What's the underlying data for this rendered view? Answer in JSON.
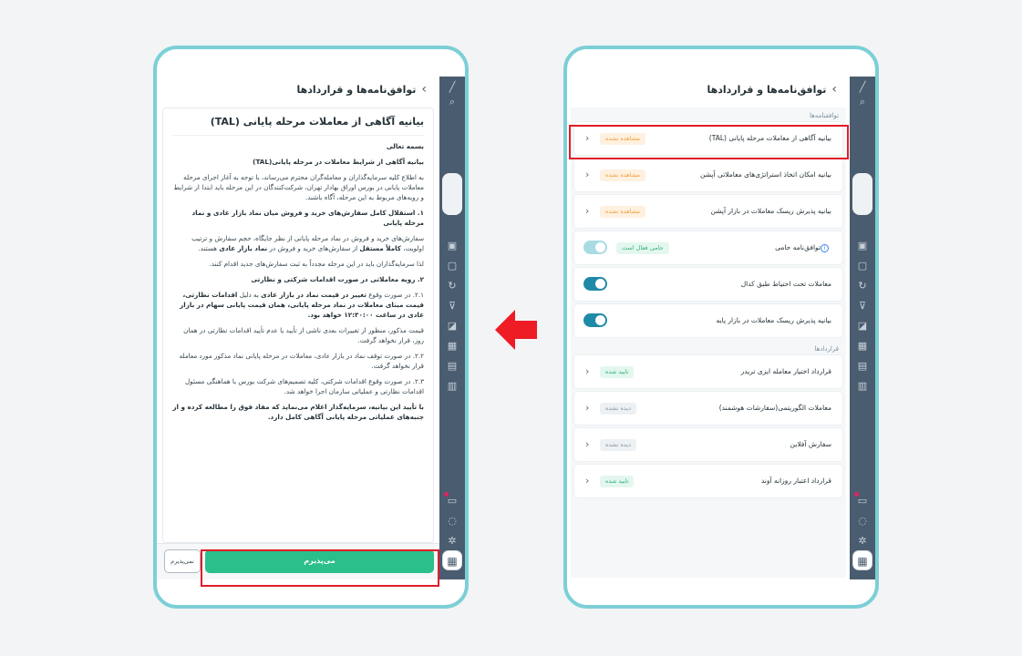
{
  "header": {
    "title": "توافق‌نامه‌ها و قراردادها"
  },
  "left": {
    "doc_title": "بیانیه آگاهی از معاملات مرحله پایانی (TAL)",
    "p_bismillah": "بسمه تعالی",
    "p_heading": "بیانیه آگاهی از شرایط معاملات در مرحله پایانی(TAL)",
    "p_intro": "به اطلاع کلیه سرمایه‌گذاران و معامله‌گران محترم می‌رساند، با توجه به آغاز اجرای مرحله معاملات پایانی در بورس اوراق بهادار تهران، شرکت‌کنندگان در این مرحله باید ابتدا از شرایط و رویه‌های مربوط به این مرحله، آگاه باشند.",
    "p_s1_title": "۱. استقلال کامل سفارش‌های خرید و فروش میان نماد بازار عادی و نماد مرحله پایانی",
    "p_s1_a": "سفارش‌های خرید و فروش در نماد مرحله پایانی از نظر جایگاه، حجم سفارش و ترتیب اولویت،",
    "p_s1_b": "کاملاً مستقل",
    "p_s1_c": "از سفارش‌های خرید و فروش در",
    "p_s1_d": "نماد بازار عادی",
    "p_s1_e": "هستند.",
    "p_s1_note": "لذا سرمایه‌گذاران باید در این مرحله مجدداً به ثبت سفارش‌های جدید اقدام کنند.",
    "p_s2_title": "۲. رویه معاملاتی در صورت اقدامات شرکتی و نظارتی",
    "p_s21_a": "۲.۱. در صورت وقوع",
    "p_s21_b": "تغییر در قیمت نماد در بازار عادی",
    "p_s21_c": "به دلیل",
    "p_s21_d": "اقدامات نظارتی، قیمت مبنای معاملات در نماد مرحله پایانی، همان قیمت پایانی سهام در بازار عادی در ساعت ۱۲:۳۰:۰۰ خواهد بود.",
    "p_s21_note": "قیمت مذکور، منظور از تغییرات بعدی ناشی از تأیید یا عدم تأیید اقدامات نظارتی در همان روز، قرار نخواهد گرفت.",
    "p_s22": "۲.۲. در صورت توقف نماد در بازار عادی، معاملات در مرحله پایانی نماد مذکور مورد معامله قرار نخواهد گرفت.",
    "p_s23": "۲.۳. در صورت وقوع اقدامات شرکتی، کلیه تصمیم‌های شرکت بورس با هماهنگی مسئول اقدامات نظارتی و عملیاتی سازمان اجرا خواهد شد.",
    "p_final": "با تأیید این بیانیه، سرمایه‌گذار اعلام می‌نماید که مفاد فوق را مطالعه کرده و از جنبه‌های عملیاتی مرحله پایانی آگاهی کامل دارد.",
    "accept_label": "می‌پذیرم",
    "reject_label": "نمی‌پذیرم"
  },
  "right": {
    "section_agreements": "توافقنامه‌ها",
    "section_contracts": "قراردادها",
    "items": [
      {
        "label": "بیانیه آگاهی از معاملات مرحله پایانی (TAL)",
        "status": "مشاهده نشده"
      },
      {
        "label": "بیانیه امکان اتخاذ استراتژی‌های معاملاتی آپشن",
        "status": "مشاهده نشده"
      },
      {
        "label": "بیانیه پذیرش ریسک معاملات در بازار آپشن",
        "status": "مشاهده نشده"
      },
      {
        "label": "توافق‌نامه حامی",
        "status": "حامی فعال است"
      },
      {
        "label": "معاملات تحت احتیاط طبق کدال",
        "status": ""
      },
      {
        "label": "بیانیه پذیرش ریسک معاملات در بازار پایه",
        "status": ""
      }
    ],
    "contracts": [
      {
        "label": "قرارداد اختیار معامله ایزی تریدر",
        "status": "تایید شده"
      },
      {
        "label": "معاملات الگوریتمی(سفارشات هوشمند)",
        "status": "دیده نشده"
      },
      {
        "label": "سفارش آفلاین",
        "status": "دیده نشده"
      },
      {
        "label": "قرارداد اعتبار روزانه آوند",
        "status": "تایید شده"
      }
    ]
  },
  "colors": {
    "accent_green": "#2bbf8b",
    "highlight_red": "#e11d2a",
    "toggle_teal": "#1f8aa8",
    "frame_teal": "#7ccfd6"
  }
}
